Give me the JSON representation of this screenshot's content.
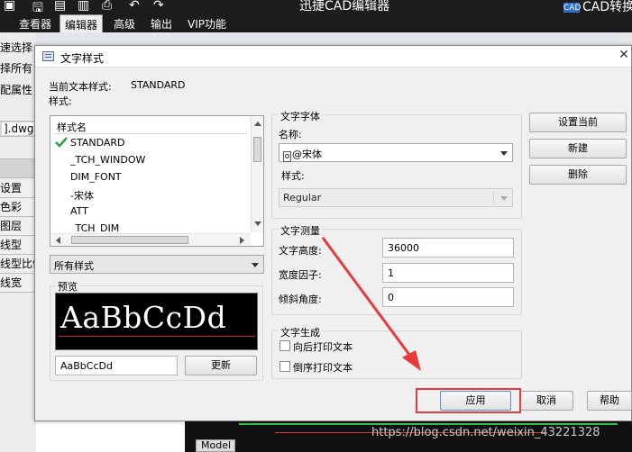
{
  "app": {
    "title": "迅捷CAD编辑器",
    "top_right": "CAD转换",
    "ribbon_tabs": [
      "查看器",
      "编辑器",
      "高级",
      "输出",
      "VIP功能"
    ],
    "active_tab": "编辑器",
    "file_tab": "].dwg",
    "left_items": [
      "速选择",
      "择所有",
      "配属性"
    ],
    "left_props": [
      "设置",
      "色彩",
      "图层",
      "线型",
      "线型比例",
      "线宽"
    ],
    "model_tab": "Model",
    "watermark": "https://blog.csdn.net/weixin_43221328"
  },
  "dialog": {
    "title": "文字样式",
    "current_label": "当前文本样式:",
    "current_value": "STANDARD",
    "styles_label": "样式:",
    "list_header": "样式名",
    "styles": [
      "STANDARD",
      "_TCH_WINDOW",
      "DIM_FONT",
      "-宋体",
      "ATT",
      "_TCH_DIM"
    ],
    "filter_value": "所有样式",
    "preview_label": "预览",
    "preview_text": "AaBbCcDd",
    "preview_input": "AaBbCcDd",
    "update_button": "更新",
    "font_group": "文字字体",
    "font_name_label": "名称:",
    "font_name_value": "@宋体",
    "font_style_label": "样式:",
    "font_style_value": "Regular",
    "measure_group": "文字测量",
    "height_label": "文字高度:",
    "height_value": "36000",
    "width_label": "宽度因子:",
    "width_value": "1",
    "oblique_label": "倾斜角度:",
    "oblique_value": "0",
    "gen_group": "文字生成",
    "backward_label": "向后打印文本",
    "upside_label": "倒序打印文本",
    "set_current_button": "设置当前",
    "new_button": "新建",
    "delete_button": "删除",
    "apply_button": "应用",
    "cancel_button": "取消",
    "help_button": "帮助"
  },
  "colors": {
    "annotation_red": "#e83a3a",
    "check_green": "#2a9a3a"
  }
}
